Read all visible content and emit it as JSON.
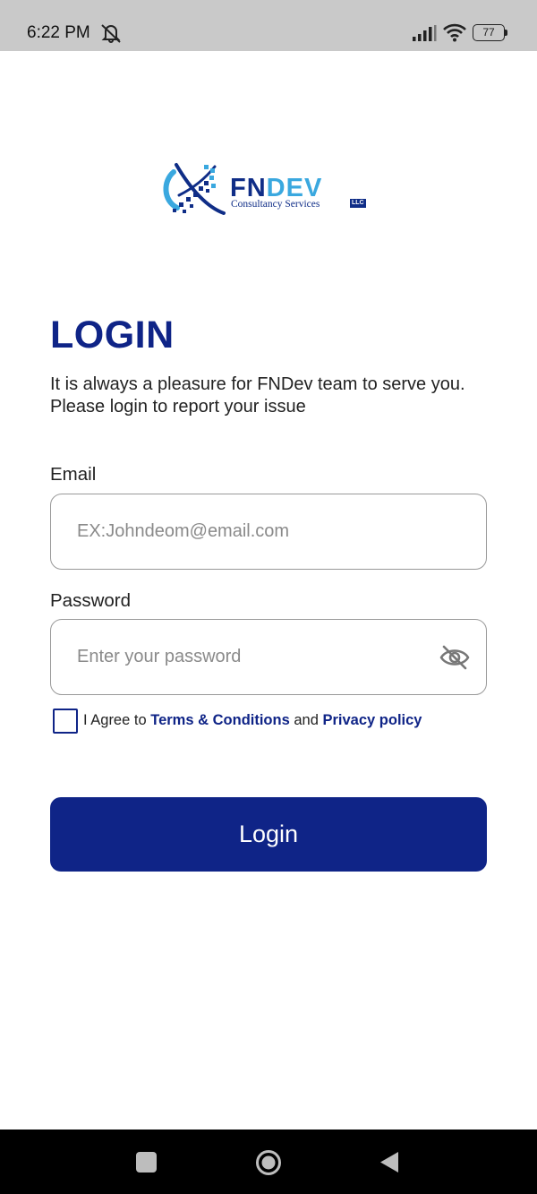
{
  "status_bar": {
    "time": "6:22 PM",
    "battery": "77",
    "icons": [
      "mute-icon",
      "signal-icon",
      "wifi-icon",
      "battery-icon"
    ]
  },
  "logo": {
    "word_part1": "FN",
    "word_part2": "DEV",
    "subtitle": "Consultancy Services",
    "badge": "LLC"
  },
  "login": {
    "title": "LOGIN",
    "subtitle": "It is always a pleasure for FNDev team to serve you. Please login to report your issue",
    "email_label": "Email",
    "email_placeholder": "EX:Johndeom@email.com",
    "password_label": "Password",
    "password_placeholder": "Enter your password",
    "agree_prefix": "I Agree to",
    "terms_link": "Terms & Conditions",
    "agree_and": "and",
    "privacy_link": "Privacy policy",
    "button_label": "Login"
  },
  "colors": {
    "primary": "#0f2487",
    "accent": "#3aa8df",
    "status_bar": "#c9c9c9",
    "nav_bar": "#000000"
  },
  "nav_bar": {
    "icons": [
      "recent-apps-icon",
      "home-icon",
      "back-icon"
    ]
  }
}
